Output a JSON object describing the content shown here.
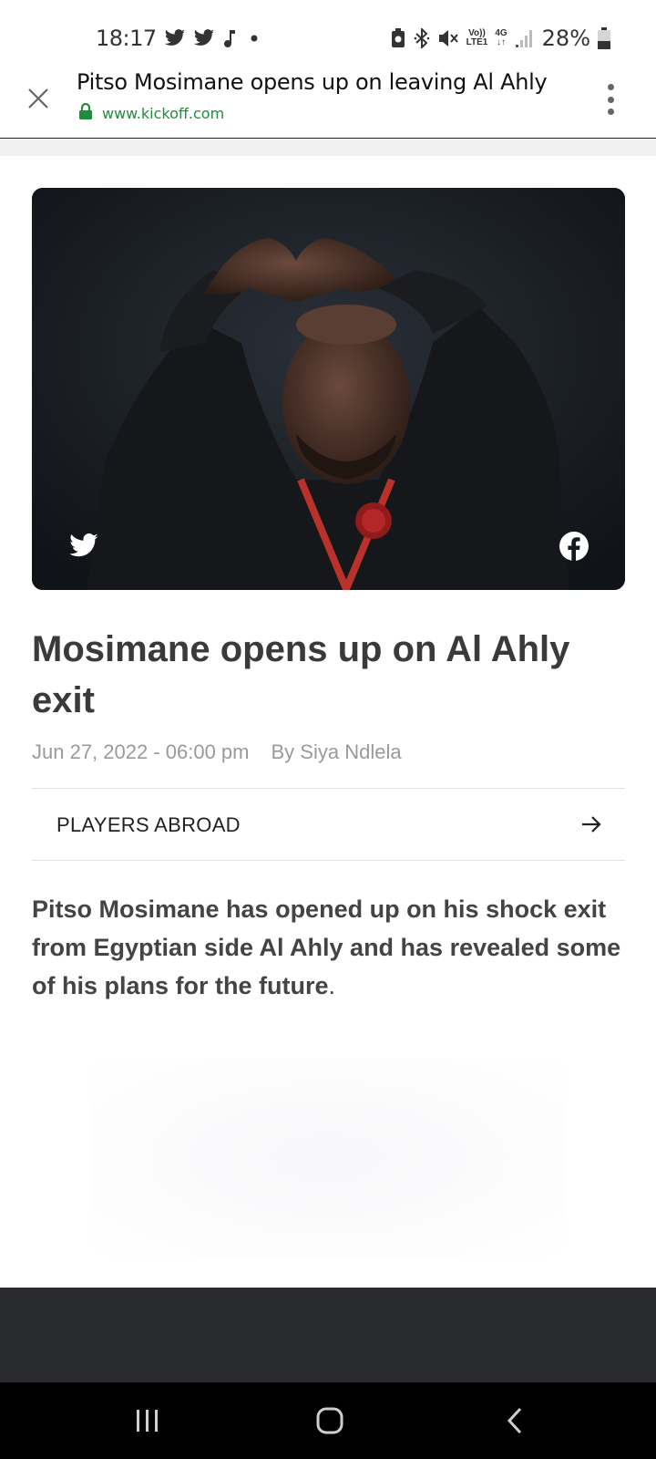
{
  "status_bar": {
    "time": "18:17",
    "battery": "28%",
    "network": {
      "volte": "Vo))",
      "lte": "LTE1",
      "gen": "4G"
    },
    "left_icons": [
      "twitter-icon",
      "twitter-icon",
      "music-note-icon",
      "dot-icon"
    ],
    "right_icons": [
      "battery-saver-icon",
      "bluetooth-icon",
      "mute-icon",
      "signal-icon",
      "battery-icon"
    ]
  },
  "tab": {
    "title": "Pitso Mosimane opens up on leaving Al Ahly",
    "url": "www.kickoff.com",
    "secure_color": "#1e8e3e"
  },
  "article": {
    "headline": "Mosimane opens up on Al Ahly exit",
    "date": "Jun 27, 2022 - 06:00 pm",
    "author": "By Siya Ndlela",
    "category": "PLAYERS ABROAD",
    "lead": "Pitso Mosimane has opened up on his shock exit from Egyptian side Al Ahly and has revealed some of his plans for the future",
    "lead_end": "."
  },
  "share": [
    "twitter-icon",
    "facebook-icon"
  ],
  "nav": [
    "recent-apps-button",
    "home-button",
    "back-button"
  ]
}
